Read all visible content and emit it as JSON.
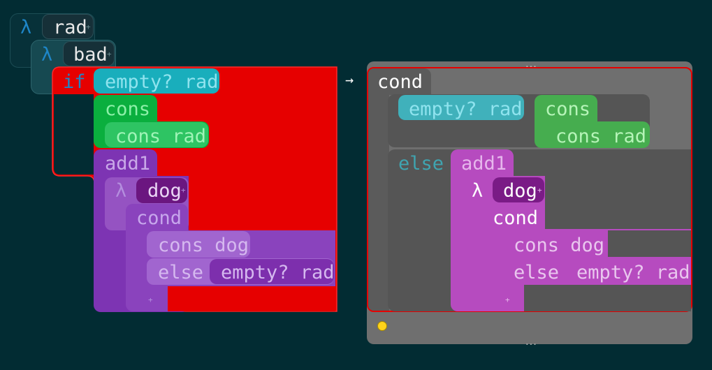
{
  "editor": {
    "lambda_outer": {
      "glyph": "λ",
      "param": "rad"
    },
    "lambda_inner": {
      "glyph": "λ",
      "param": "bad"
    },
    "if_keyword": "if",
    "if_condition": "empty? rad",
    "then_head": "cons",
    "then_arg": "cons rad",
    "else_head": "add1",
    "else_lambda": {
      "glyph": "λ",
      "param": "dog"
    },
    "else_cond": "cond",
    "else_cond_clause1": "cons dog",
    "else_cond_clause2_keyword": "else",
    "else_cond_clause2_value": "empty? rad",
    "add_symbol": "+",
    "arrow": "→"
  },
  "preview": {
    "cond_keyword": "cond",
    "clause1_test": "empty? rad",
    "clause1_head": "cons",
    "clause1_arg": "cons rad",
    "else_keyword": "else",
    "else_head": "add1",
    "lambda": {
      "glyph": "λ",
      "param": "dog"
    },
    "inner_cond": "cond",
    "inner_clause1": "cons dog",
    "inner_else_keyword": "else",
    "inner_else_value": "empty? rad",
    "add_symbol": "+",
    "menu_dots": "..."
  },
  "colors": {
    "background": "#022c33",
    "lambda_box": "#0c3a42",
    "lambda_box_inner": "#1b4e57",
    "highlight_red": "#e60000",
    "teal_pill": "#19aebc",
    "green_block": "#0aaf3e",
    "purple_block": "#7d34b3",
    "magenta_block": "#b64bbf",
    "preview_panel": "#6f6f6f",
    "status_dot": "#ffd31a"
  },
  "icons": [
    "lambda-icon",
    "arrow-right-icon",
    "add-icon",
    "status-dot-icon",
    "more-icon"
  ]
}
